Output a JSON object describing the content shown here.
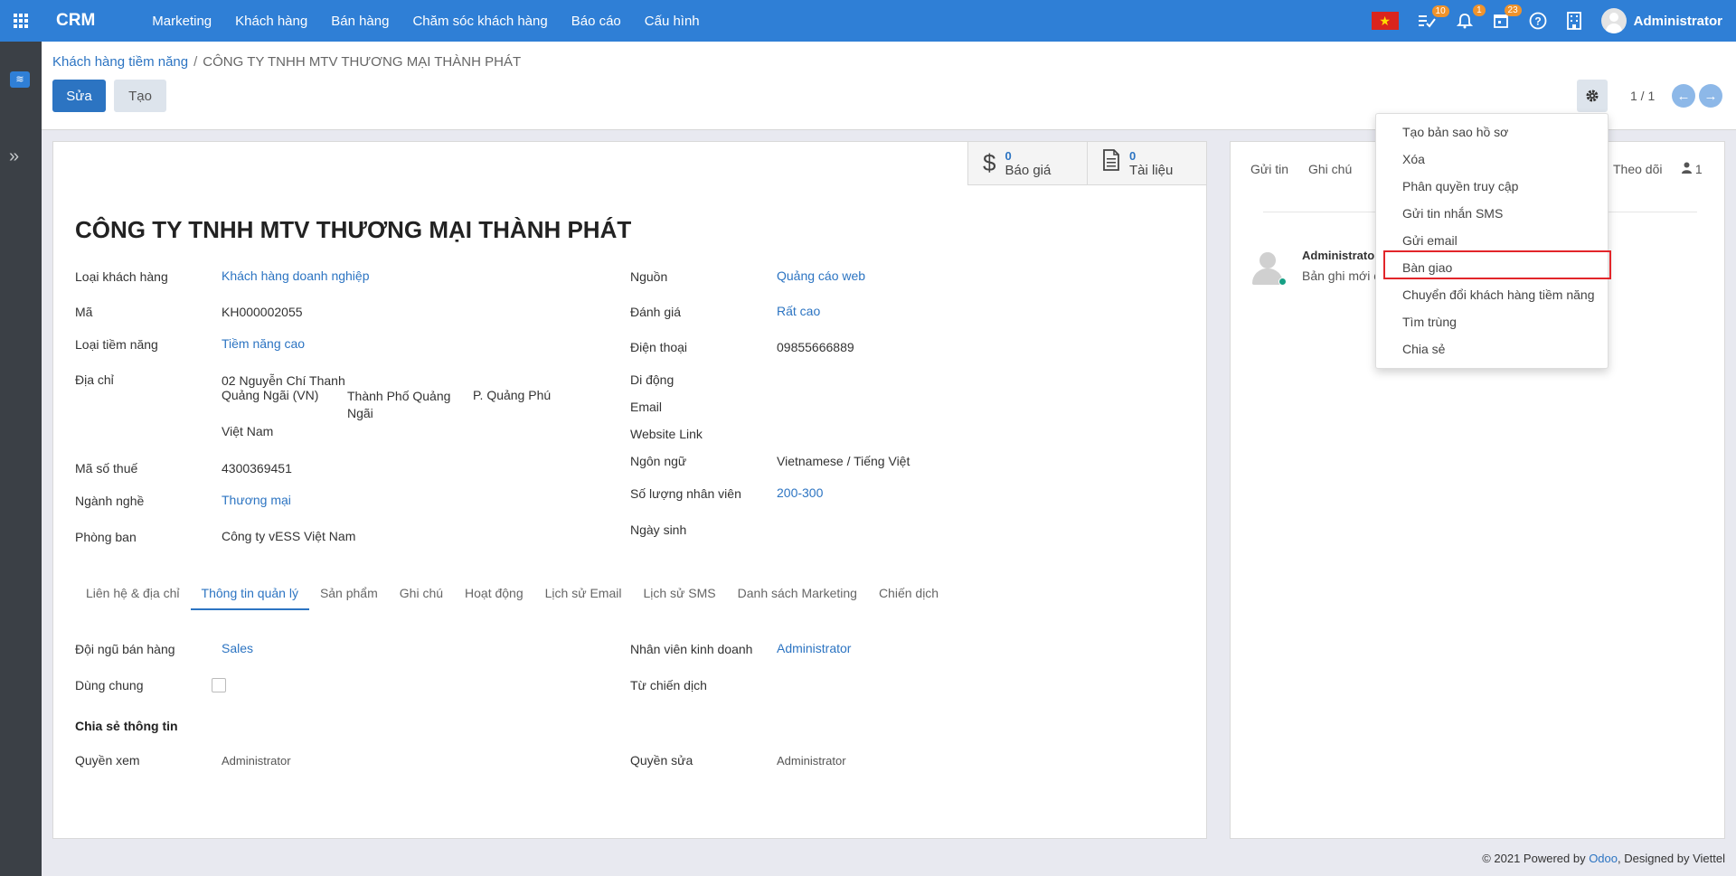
{
  "topbar": {
    "brand": "CRM",
    "menu": [
      "Marketing",
      "Khách hàng",
      "Bán hàng",
      "Chăm sóc khách hàng",
      "Báo cáo",
      "Cấu hình"
    ],
    "badges": {
      "activities": "10",
      "notifications": "1",
      "calendar": "23"
    },
    "user": "Administrator"
  },
  "breadcrumb": {
    "parent": "Khách hàng tiềm năng",
    "separator": "/",
    "current": "CÔNG TY TNHH MTV THƯƠNG MẠI THÀNH PHÁT"
  },
  "buttons": {
    "edit": "Sửa",
    "create": "Tạo"
  },
  "pager": "1 / 1",
  "smart_buttons": [
    {
      "count": "0",
      "label": "Báo giá"
    },
    {
      "count": "0",
      "label": "Tài liệu"
    }
  ],
  "record": {
    "title": "CÔNG TY TNHH MTV THƯƠNG MẠI THÀNH PHÁT",
    "left_fields": {
      "customer_type": {
        "label": "Loại khách hàng",
        "value": "Khách hàng doanh nghiệp"
      },
      "code": {
        "label": "Mã",
        "value": "KH000002055"
      },
      "potential_type": {
        "label": "Loại tiềm năng",
        "value": "Tiềm năng cao"
      },
      "address": {
        "label": "Địa chỉ",
        "street": "02 Nguyễn Chí Thanh",
        "state": "Quảng Ngãi (VN)",
        "city": "Thành Phố Quảng Ngãi",
        "ward": "P. Quảng Phú",
        "country": "Việt Nam"
      },
      "tax_code": {
        "label": "Mã số thuế",
        "value": "4300369451"
      },
      "industry": {
        "label": "Ngành nghề",
        "value": "Thương mại"
      },
      "department": {
        "label": "Phòng ban",
        "value": "Công ty vESS Việt Nam"
      }
    },
    "right_fields": {
      "source": {
        "label": "Nguồn",
        "value": "Quảng cáo web"
      },
      "rating": {
        "label": "Đánh giá",
        "value": "Rất cao"
      },
      "phone": {
        "label": "Điện thoại",
        "value": "09855666889"
      },
      "mobile": {
        "label": "Di động",
        "value": ""
      },
      "email": {
        "label": "Email",
        "value": ""
      },
      "website": {
        "label": "Website Link",
        "value": ""
      },
      "language": {
        "label": "Ngôn ngữ",
        "value": "Vietnamese / Tiếng Việt"
      },
      "employees": {
        "label": "Số lượng nhân viên",
        "value": "200-300"
      },
      "birthday": {
        "label": "Ngày sinh",
        "value": ""
      }
    }
  },
  "tabs": [
    "Liên hệ & địa chỉ",
    "Thông tin quản lý",
    "Sản phẩm",
    "Ghi chú",
    "Hoạt động",
    "Lịch sử Email",
    "Lịch sử SMS",
    "Danh sách Marketing",
    "Chiến dịch"
  ],
  "active_tab": "Thông tin quản lý",
  "management": {
    "sales_team": {
      "label": "Đội ngũ bán hàng",
      "value": "Sales"
    },
    "shared": {
      "label": "Dùng chung",
      "checked": false
    },
    "salesperson": {
      "label": "Nhân viên kinh doanh",
      "value": "Administrator"
    },
    "campaign": {
      "label": "Từ chiến dịch",
      "value": ""
    },
    "share_section": "Chia sẻ thông tin",
    "view_rights": {
      "label": "Quyền xem",
      "value": "Administrator"
    },
    "edit_rights": {
      "label": "Quyền sửa",
      "value": "Administrator"
    }
  },
  "chatter": {
    "send_message": "Gửi tin",
    "log_note": "Ghi chú",
    "follow": "Theo dõi",
    "followers": "1",
    "message_author": "Administrato",
    "message_body": "Bản ghi mới c"
  },
  "dropdown": {
    "items": [
      "Tạo bản sao hồ sơ",
      "Xóa",
      "Phân quyền truy cập",
      "Gửi tin nhắn SMS",
      "Gửi email",
      "Bàn giao",
      "Chuyển đổi khách hàng tiềm năng",
      "Tìm trùng",
      "Chia sẻ"
    ],
    "highlighted": "Bàn giao"
  },
  "footer": {
    "prefix": "© 2021 Powered by ",
    "odoo": "Odoo",
    "suffix": ", Designed by Viettel"
  }
}
